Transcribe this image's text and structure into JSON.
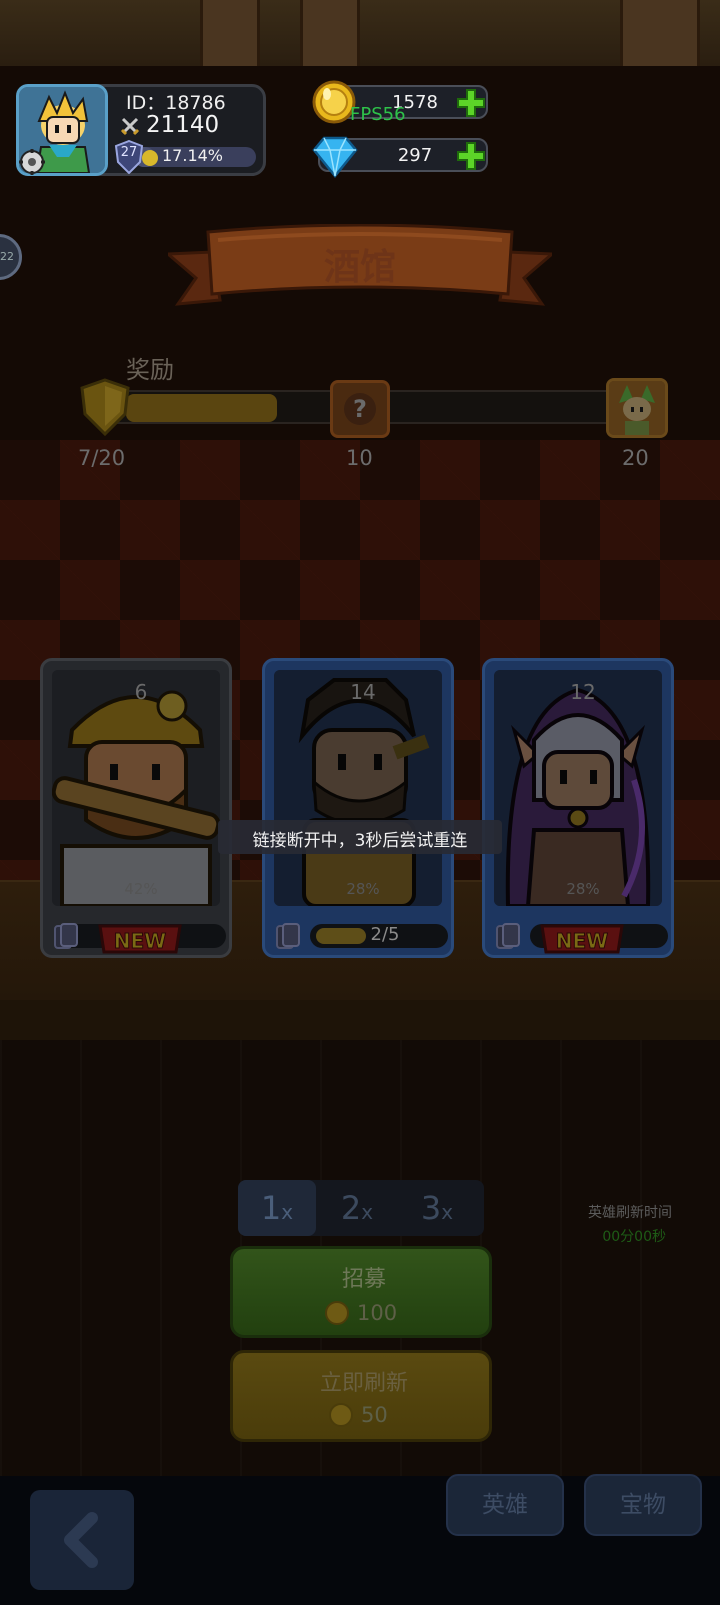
{
  "player": {
    "id_text": "ID：18786",
    "power": "21140",
    "level": "27",
    "xp_percent": "17.14%",
    "xp_fraction": 0.17
  },
  "currency": {
    "gold": "1578",
    "gems": "297"
  },
  "debug": {
    "fps": "FPS56"
  },
  "side_bubble": "22",
  "tavern": {
    "title": "酒馆",
    "reward_label": "奖励",
    "reward_progress_text": "7/20",
    "reward_progress_fraction": 0.35,
    "milestones": [
      "10",
      "20"
    ]
  },
  "cards": [
    {
      "level": "6",
      "percent": "42%",
      "badge": "NEW",
      "frame": "gray",
      "accent": "#3a3c40"
    },
    {
      "level": "14",
      "percent": "28%",
      "count": "2/5",
      "count_fraction": 0.4,
      "frame": "blue",
      "accent": "#1f3a60"
    },
    {
      "level": "12",
      "percent": "28%",
      "badge": "NEW",
      "frame": "blue",
      "accent": "#1f3a60"
    }
  ],
  "toast": "链接断开中，3秒后尝试重连",
  "multiplier": {
    "options": [
      {
        "num": "1",
        "suffix": "x"
      },
      {
        "num": "2",
        "suffix": "x"
      },
      {
        "num": "3",
        "suffix": "x"
      }
    ],
    "selected": "1"
  },
  "hero_refresh": {
    "label": "英雄刷新时间",
    "timer": "00分00秒"
  },
  "actions": {
    "recruit": {
      "title": "招募",
      "cost": "100"
    },
    "refresh": {
      "title": "立即刷新",
      "cost": "50"
    }
  },
  "nav": {
    "tabs": [
      "英雄",
      "宝物"
    ]
  },
  "colors": {
    "gold": "#e9b81c",
    "gem": "#36b4f0",
    "plus": "#5cd428",
    "fps": "#2ec24a",
    "recruit": "#32541a",
    "refresh": "#5a4a10"
  }
}
